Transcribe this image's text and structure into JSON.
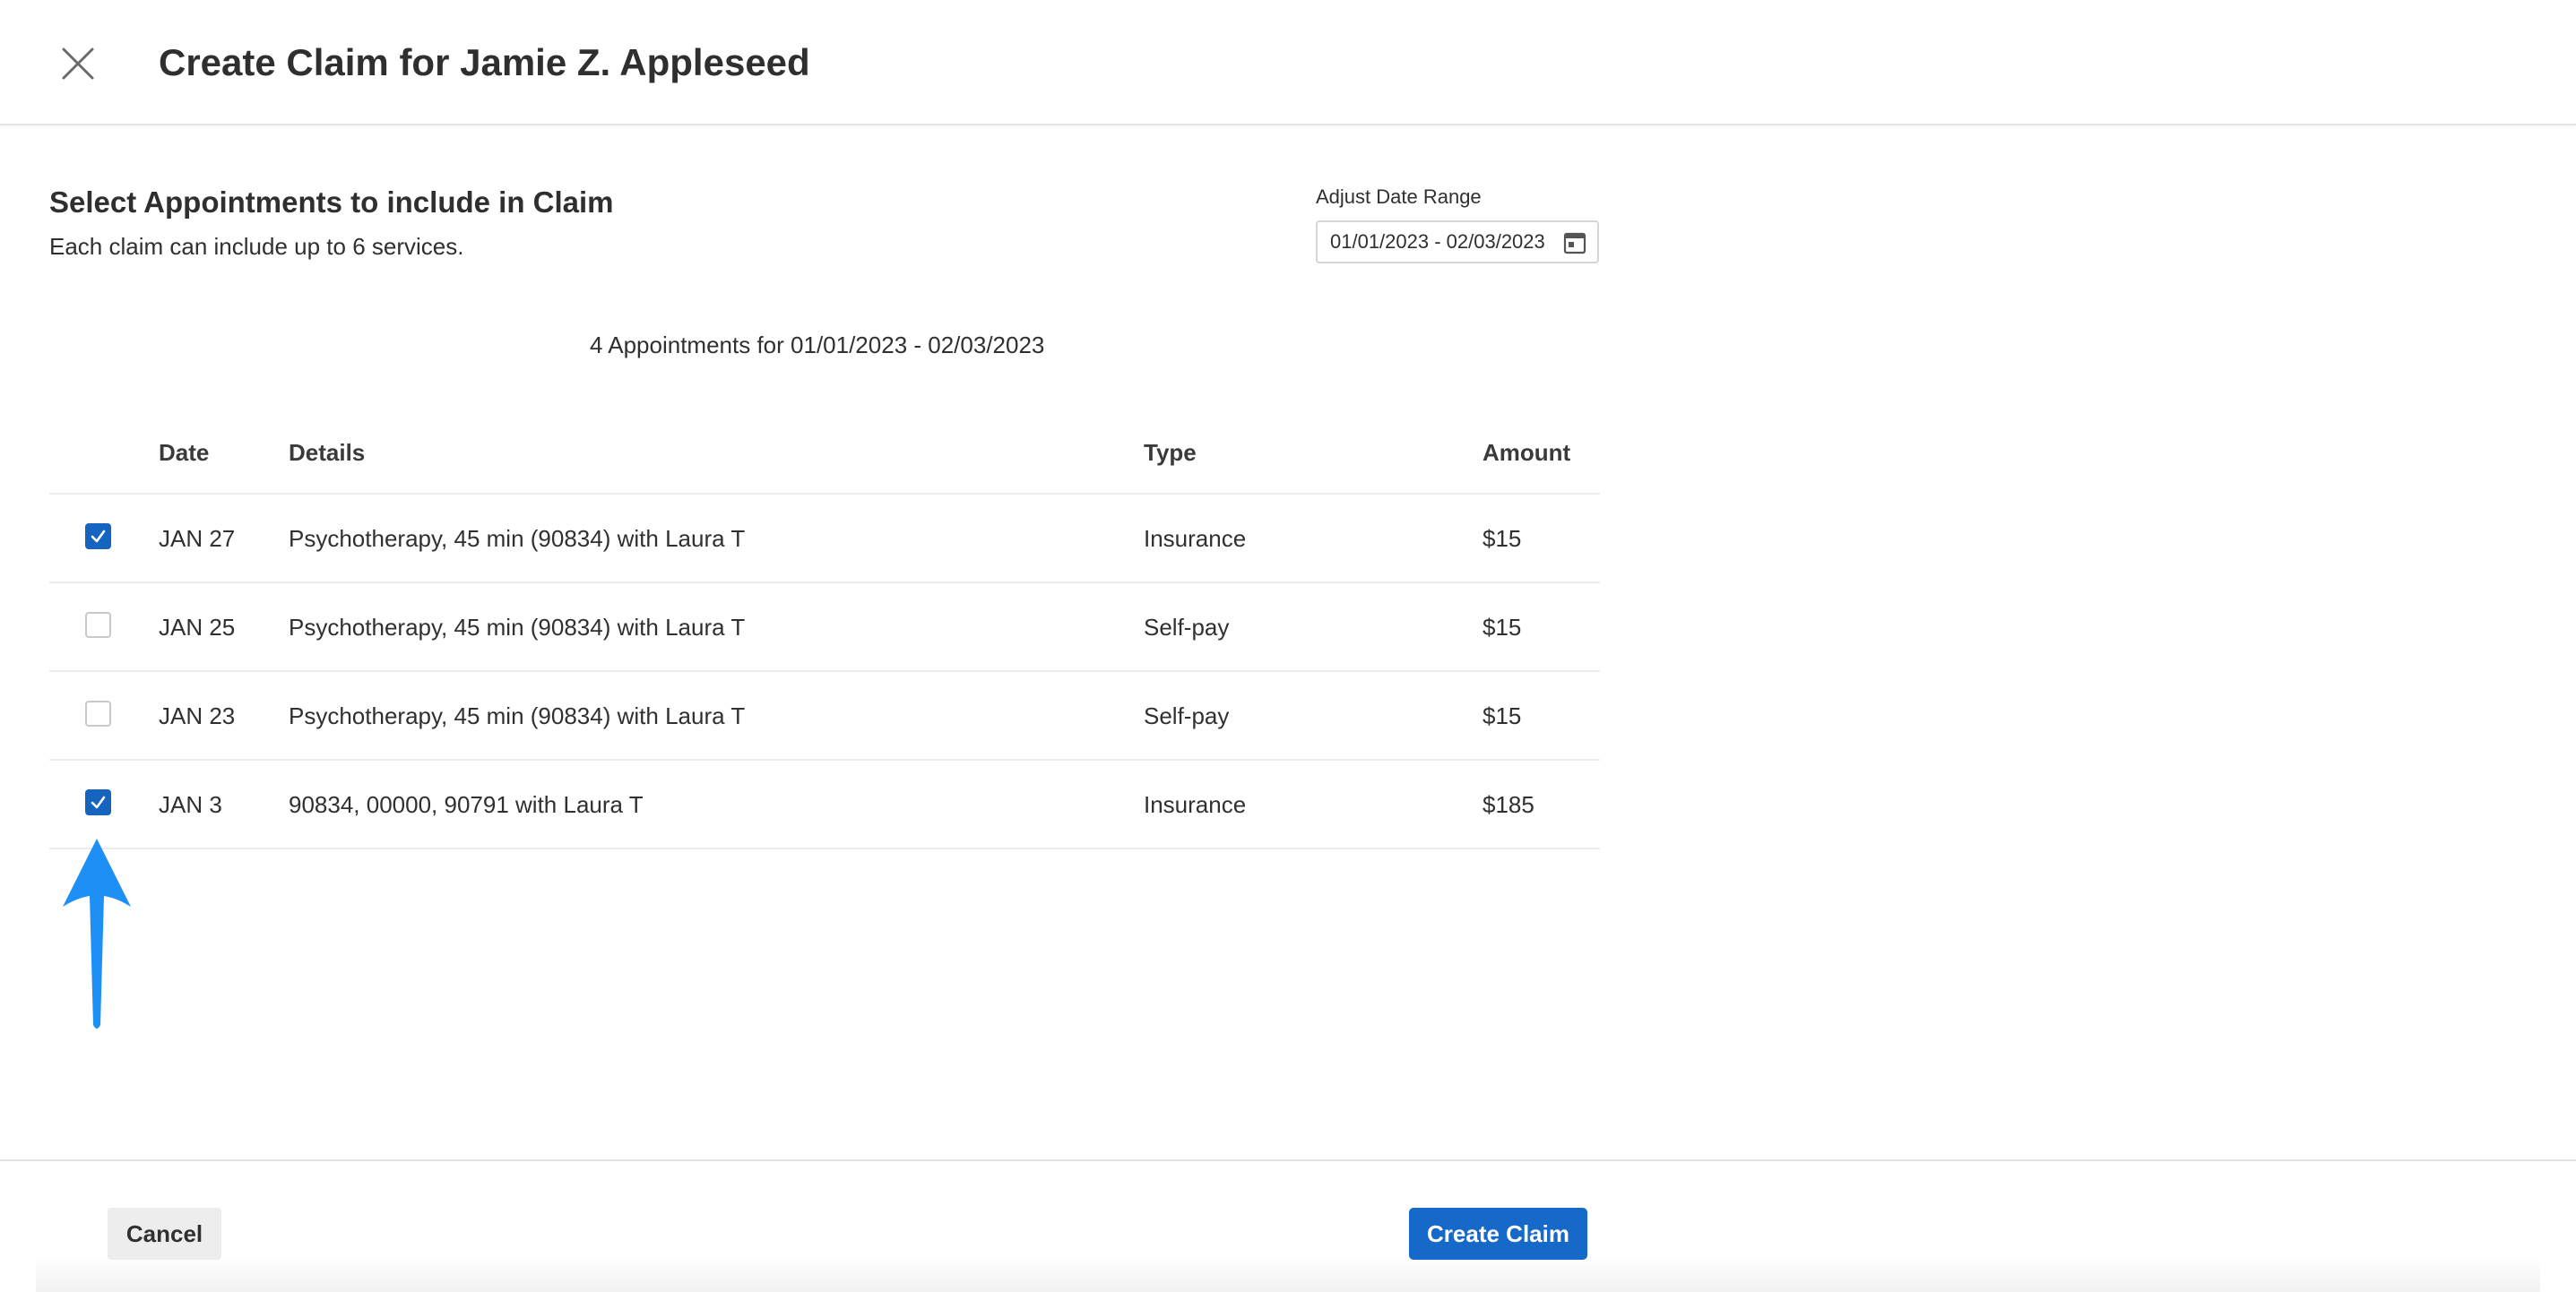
{
  "header": {
    "title": "Create Claim for Jamie Z. Appleseed",
    "close_icon": "close-icon"
  },
  "section": {
    "title": "Select Appointments to include in Claim",
    "subtitle": "Each claim can include up to 6 services."
  },
  "date_range": {
    "label": "Adjust Date Range",
    "value": "01/01/2023 - 02/03/2023",
    "icon": "calendar-icon"
  },
  "appointments_summary": "4 Appointments for 01/01/2023 - 02/03/2023",
  "table": {
    "columns": [
      "Date",
      "Details",
      "Type",
      "Amount"
    ],
    "rows": [
      {
        "checked": true,
        "date": "JAN 27",
        "details": "Psychotherapy, 45 min (90834) with Laura T",
        "type": "Insurance",
        "amount": "$15"
      },
      {
        "checked": false,
        "date": "JAN 25",
        "details": "Psychotherapy, 45 min (90834) with Laura T",
        "type": "Self-pay",
        "amount": "$15"
      },
      {
        "checked": false,
        "date": "JAN 23",
        "details": "Psychotherapy, 45 min (90834) with Laura T",
        "type": "Self-pay",
        "amount": "$15"
      },
      {
        "checked": true,
        "date": "JAN 3",
        "details": "90834, 00000, 90791 with Laura T",
        "type": "Insurance",
        "amount": "$185"
      }
    ]
  },
  "annotation": {
    "icon": "arrow-up-icon",
    "color": "#1e8ff5"
  },
  "footer": {
    "cancel_label": "Cancel",
    "create_label": "Create Claim"
  },
  "colors": {
    "primary": "#1769c9",
    "checkbox_checked": "#1565c0"
  }
}
